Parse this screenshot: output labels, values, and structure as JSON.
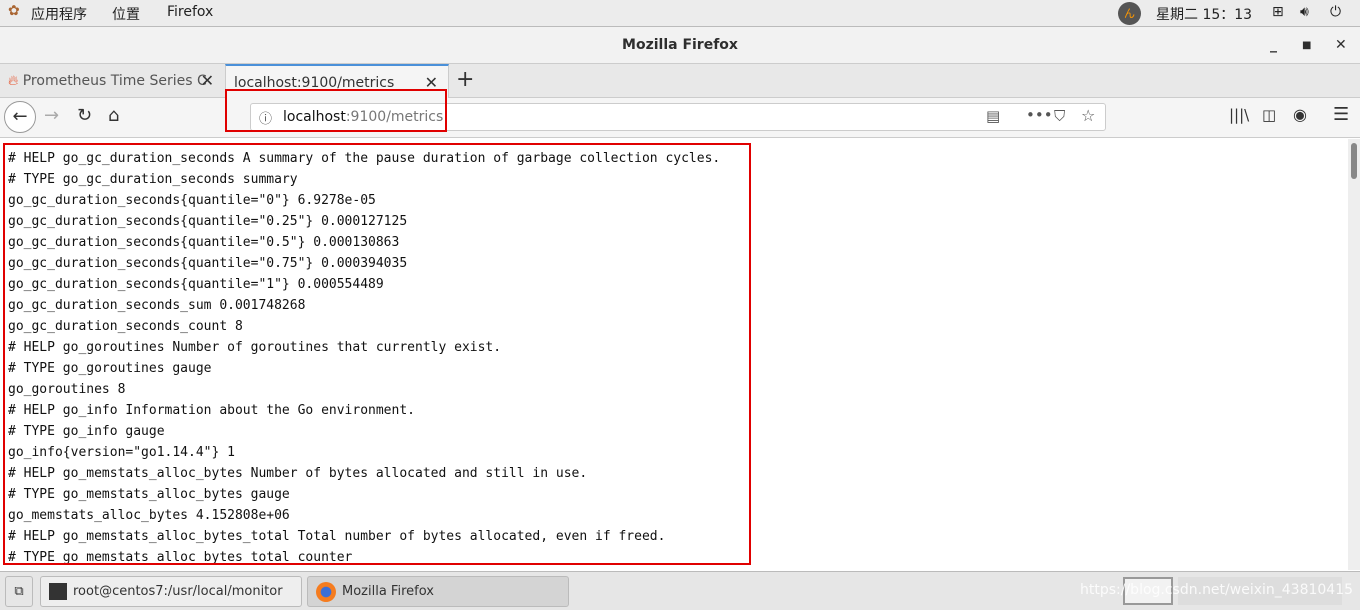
{
  "topbar": {
    "apps": "应用程序",
    "places": "位置",
    "firefox": "Firefox",
    "clock": "星期二 15：13"
  },
  "window": {
    "title": "Mozilla Firefox"
  },
  "tabs": [
    {
      "label": "Prometheus Time Series C"
    },
    {
      "label": "localhost:9100/metrics"
    }
  ],
  "url": {
    "host": "localhost",
    "path": ":9100/metrics"
  },
  "content": {
    "lines": [
      "# HELP go_gc_duration_seconds A summary of the pause duration of garbage collection cycles.",
      "# TYPE go_gc_duration_seconds summary",
      "go_gc_duration_seconds{quantile=\"0\"} 6.9278e-05",
      "go_gc_duration_seconds{quantile=\"0.25\"} 0.000127125",
      "go_gc_duration_seconds{quantile=\"0.5\"} 0.000130863",
      "go_gc_duration_seconds{quantile=\"0.75\"} 0.000394035",
      "go_gc_duration_seconds{quantile=\"1\"} 0.000554489",
      "go_gc_duration_seconds_sum 0.001748268",
      "go_gc_duration_seconds_count 8",
      "# HELP go_goroutines Number of goroutines that currently exist.",
      "# TYPE go_goroutines gauge",
      "go_goroutines 8",
      "# HELP go_info Information about the Go environment.",
      "# TYPE go_info gauge",
      "go_info{version=\"go1.14.4\"} 1",
      "# HELP go_memstats_alloc_bytes Number of bytes allocated and still in use.",
      "# TYPE go_memstats_alloc_bytes gauge",
      "go_memstats_alloc_bytes 4.152808e+06",
      "# HELP go_memstats_alloc_bytes_total Total number of bytes allocated, even if freed.",
      "# TYPE go_memstats_alloc_bytes_total counter"
    ]
  },
  "taskbar": {
    "terminal": "root@centos7:/usr/local/monitor",
    "firefox": "Mozilla Firefox",
    "watermark": "https://blog.csdn.net/weixin_43810415"
  },
  "colors": {
    "highlight": "#e00000",
    "tab_accent": "#4a90d9"
  }
}
